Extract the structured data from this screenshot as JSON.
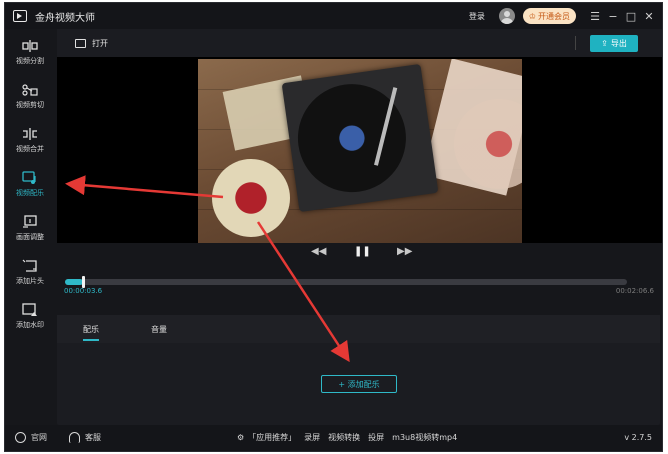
{
  "app": {
    "title": "金舟视频大师",
    "version": "v 2.7.5"
  },
  "titlebar": {
    "login": "登录",
    "vip_label": "开通会员",
    "window_controls": [
      "☰",
      "−",
      "□",
      "✕"
    ]
  },
  "sidebar": {
    "items": [
      {
        "label": "视频分割",
        "icon": "split-icon",
        "active": false
      },
      {
        "label": "视频剪切",
        "icon": "scissors-icon",
        "active": false
      },
      {
        "label": "视频合并",
        "icon": "merge-icon",
        "active": false
      },
      {
        "label": "视频配乐",
        "icon": "music-icon",
        "active": true
      },
      {
        "label": "画面调整",
        "icon": "crop-icon",
        "active": false
      },
      {
        "label": "添加片头",
        "icon": "intro-icon",
        "active": false
      },
      {
        "label": "添加水印",
        "icon": "watermark-icon",
        "active": false
      }
    ]
  },
  "toolbar": {
    "open_label": "打开",
    "export_label": "导出"
  },
  "player": {
    "controls": [
      "◀◀",
      "❚❚",
      "▶▶"
    ],
    "current_time": "00:00:03.6",
    "total_time": "00:02:06.6",
    "progress": 0.032
  },
  "panel": {
    "tabs": [
      {
        "label": "配乐",
        "active": true
      },
      {
        "label": "音量",
        "active": false
      }
    ],
    "add_music_label": "+ 添加配乐"
  },
  "statusbar": {
    "website": "官网",
    "support": "客服",
    "recommend": "「应用推荐」",
    "links": [
      "录屏",
      "视频转换",
      "投屏",
      "m3u8视频转mp4"
    ]
  },
  "colors": {
    "accent": "#2fb9c8",
    "annotation": "#e53935",
    "background": "#16171b"
  }
}
